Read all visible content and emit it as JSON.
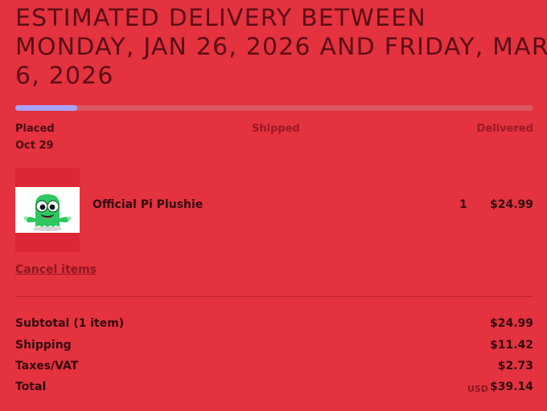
{
  "heading": "ESTIMATED DELIVERY BETWEEN MONDAY, JAN 26, 2026 AND FRIDAY, MAR 6, 2026",
  "progress": {
    "value": 0.12,
    "fill_color": "#a9a2ff",
    "track_color": "#dc5561"
  },
  "steps": [
    {
      "label": "Placed",
      "date": "Oct 29"
    },
    {
      "label": "Shipped"
    },
    {
      "label": "Delivered"
    }
  ],
  "item": {
    "name": "Official Pi Plushie",
    "quantity": "1",
    "price": "$24.99",
    "image": "green-plush-toy"
  },
  "cancel_label": "Cancel items",
  "summary": {
    "subtotal_label": "Subtotal (1 item)",
    "subtotal_value": "$24.99",
    "shipping_label": "Shipping",
    "shipping_value": "$11.42",
    "taxes_label": "Taxes/VAT",
    "taxes_value": "$2.73",
    "total_label": "Total",
    "currency": "USD",
    "total_value": "$39.14"
  },
  "colors": {
    "background": "#e4323f",
    "heading_text": "#5b0d15",
    "accent_progress": "#a9a2ff"
  }
}
